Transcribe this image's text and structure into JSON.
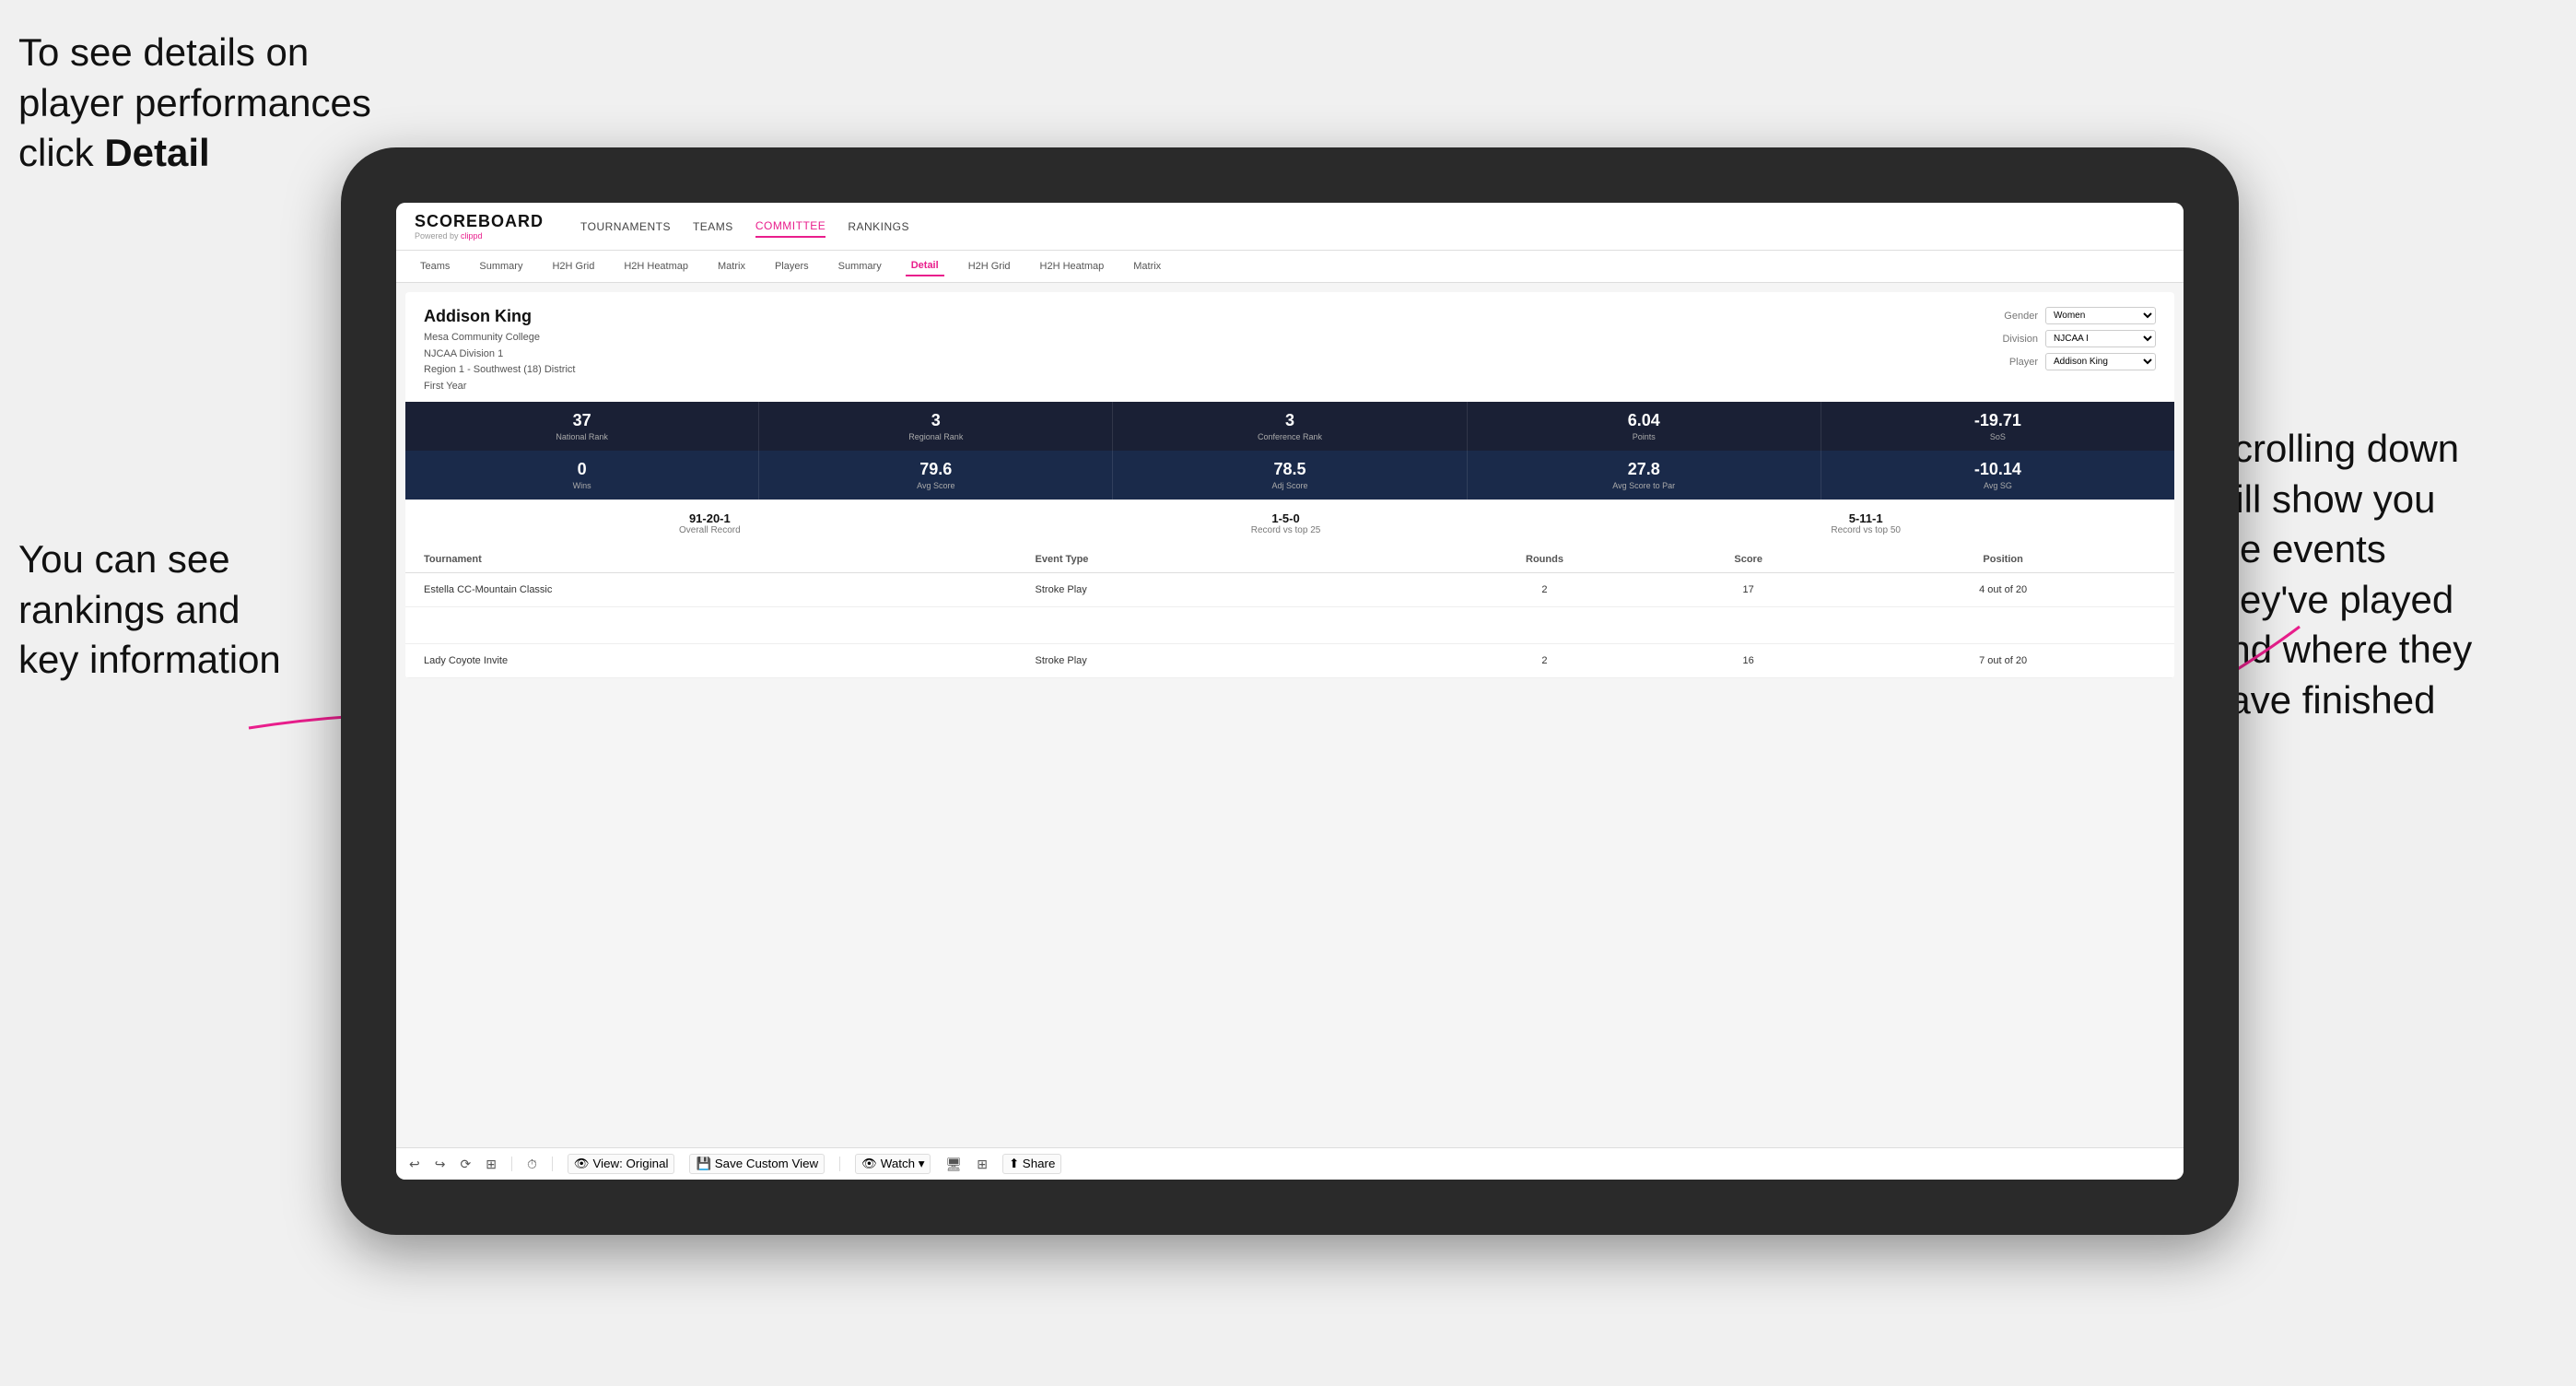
{
  "annotations": {
    "top_left": {
      "line1": "To see details on",
      "line2": "player performances",
      "line3": "click ",
      "line3_bold": "Detail"
    },
    "bottom_left": {
      "line1": "You can see",
      "line2": "rankings and",
      "line3": "key information"
    },
    "bottom_right": {
      "line1": "Scrolling down",
      "line2": "will show you",
      "line3": "the events",
      "line4": "they've played",
      "line5": "and where they",
      "line6": "have finished"
    }
  },
  "header": {
    "logo": "SCOREBOARD",
    "powered_by": "Powered by clippd",
    "nav": [
      "TOURNAMENTS",
      "TEAMS",
      "COMMITTEE",
      "RANKINGS"
    ]
  },
  "sub_nav": {
    "items": [
      "Teams",
      "Summary",
      "H2H Grid",
      "H2H Heatmap",
      "Matrix",
      "Players",
      "Summary",
      "Detail",
      "H2H Grid",
      "H2H Heatmap",
      "Matrix"
    ],
    "active": "Detail"
  },
  "player": {
    "name": "Addison King",
    "school": "Mesa Community College",
    "division": "NJCAA Division 1",
    "region": "Region 1 - Southwest (18) District",
    "year": "First Year",
    "gender_label": "Gender",
    "gender_value": "Women",
    "division_label": "Division",
    "division_value": "NJCAA I",
    "player_label": "Player",
    "player_value": "Addison King"
  },
  "stats_row1": [
    {
      "value": "37",
      "label": "National Rank"
    },
    {
      "value": "3",
      "label": "Regional Rank"
    },
    {
      "value": "3",
      "label": "Conference Rank"
    },
    {
      "value": "6.04",
      "label": "Points"
    },
    {
      "value": "-19.71",
      "label": "SoS"
    }
  ],
  "stats_row2": [
    {
      "value": "0",
      "label": "Wins"
    },
    {
      "value": "79.6",
      "label": "Avg Score"
    },
    {
      "value": "78.5",
      "label": "Adj Score"
    },
    {
      "value": "27.8",
      "label": "Avg Score to Par"
    },
    {
      "value": "-10.14",
      "label": "Avg SG"
    }
  ],
  "records": [
    {
      "value": "91-20-1",
      "label": "Overall Record"
    },
    {
      "value": "1-5-0",
      "label": "Record vs top 25"
    },
    {
      "value": "5-11-1",
      "label": "Record vs top 50"
    }
  ],
  "table": {
    "headers": [
      "Tournament",
      "Event Type",
      "Rounds",
      "Score",
      "Position"
    ],
    "rows": [
      {
        "tournament": "Estella CC-Mountain Classic",
        "event_type": "Stroke Play",
        "rounds": "2",
        "score": "17",
        "position": "4 out of 20"
      },
      {
        "tournament": "",
        "event_type": "",
        "rounds": "",
        "score": "",
        "position": ""
      },
      {
        "tournament": "Lady Coyote Invite",
        "event_type": "Stroke Play",
        "rounds": "2",
        "score": "16",
        "position": "7 out of 20"
      }
    ]
  },
  "toolbar": {
    "items": [
      "View: Original",
      "Save Custom View",
      "Watch",
      "Share"
    ]
  }
}
